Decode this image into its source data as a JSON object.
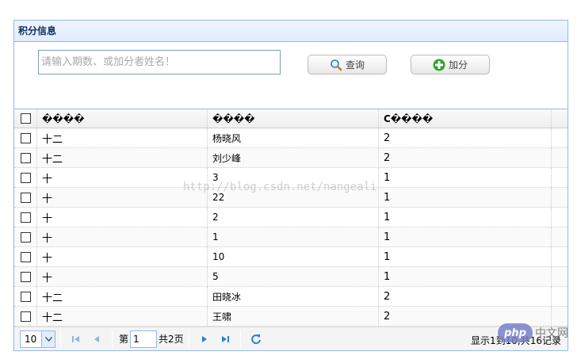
{
  "panel": {
    "title": "积分信息"
  },
  "search": {
    "placeholder": "请输入期数、或加分者姓名！"
  },
  "buttons": {
    "query": "查询",
    "add": "加分"
  },
  "grid": {
    "headers": [
      "����",
      "����",
      "C����"
    ],
    "rows": [
      [
        "十二",
        "杨晓风",
        "2"
      ],
      [
        "十二",
        "刘少峰",
        "2"
      ],
      [
        "十",
        "3",
        "1"
      ],
      [
        "十",
        "22",
        "1"
      ],
      [
        "十",
        "2",
        "1"
      ],
      [
        "十",
        "1",
        "1"
      ],
      [
        "十",
        "10",
        "1"
      ],
      [
        "十",
        "5",
        "1"
      ],
      [
        "十二",
        "田晓冰",
        "2"
      ],
      [
        "十二",
        "王啸",
        "2"
      ]
    ]
  },
  "pager": {
    "page_size": "10",
    "page_prefix": "第",
    "current_page": "1",
    "total_pages": "共2页",
    "info": "显示1到10,共16记录"
  },
  "watermark": {
    "text": "http://blog.csdn.net/nangeali",
    "logo": "php",
    "logo_suffix": "中文网"
  },
  "colors": {
    "border": "#95b8e7",
    "header_bg": "#e0ecff",
    "nav_icon": "#2c7fd1",
    "add_icon": "#2ea32e"
  }
}
